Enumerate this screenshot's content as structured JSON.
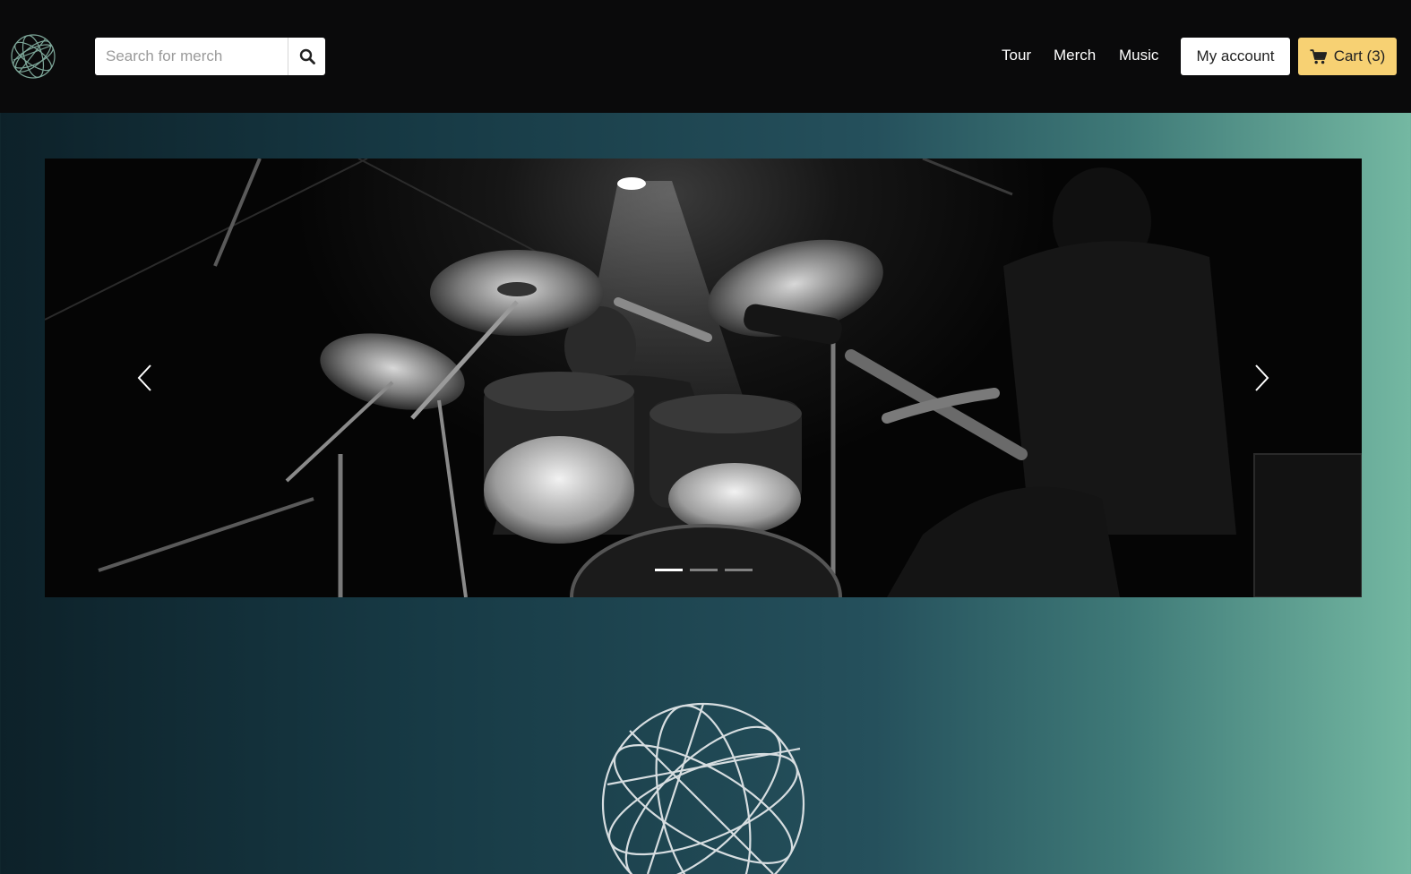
{
  "header": {
    "logo_icon": "wireframe-globe-icon",
    "search": {
      "placeholder": "Search for merch",
      "value": "",
      "button_icon": "search-icon"
    },
    "nav": [
      {
        "label": "Tour"
      },
      {
        "label": "Merch"
      },
      {
        "label": "Music"
      }
    ],
    "account_label": "My account",
    "cart": {
      "label": "Cart (3)",
      "icon": "shopping-cart-icon"
    }
  },
  "carousel": {
    "slide_image": "black-and-white photo of a drummer behind a drum kit and a guitarist on stage",
    "prev_icon": "chevron-left-icon",
    "next_icon": "chevron-right-icon",
    "slide_count": 3,
    "active_index": 0
  },
  "colors": {
    "topbar_bg": "#0a0a0b",
    "cart_bg": "#f7d173",
    "gradient_dark": "#0d2129",
    "gradient_light": "#74b8a2"
  }
}
